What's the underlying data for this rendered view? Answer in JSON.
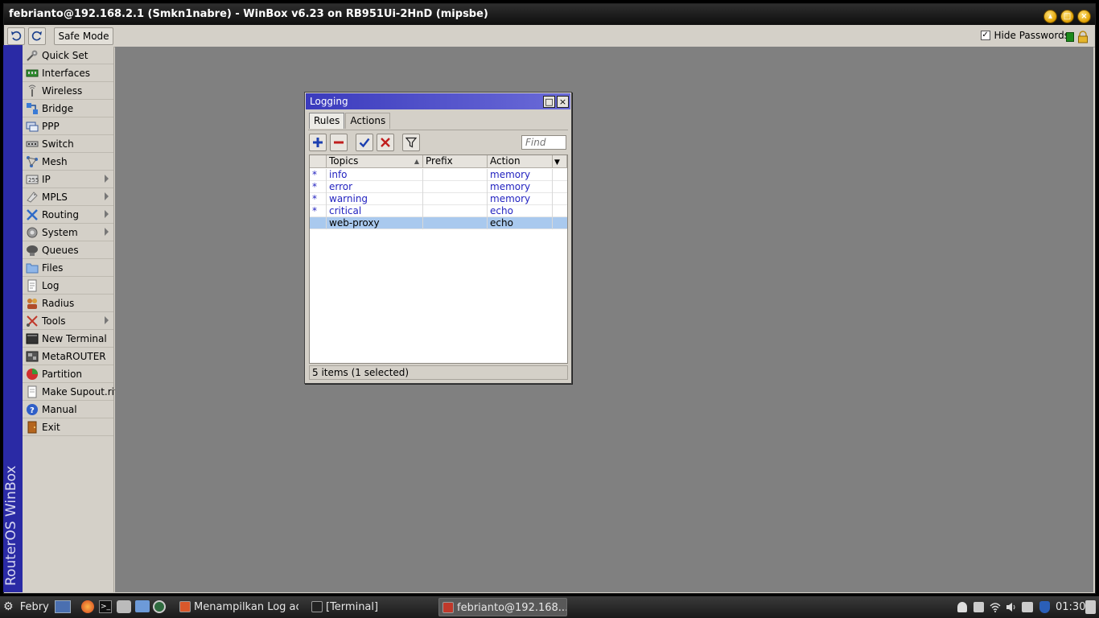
{
  "window": {
    "title": "febrianto@192.168.2.1 (Smkn1nabre) - WinBox v6.23 on RB951Ui-2HnD (mipsbe)"
  },
  "toolbar": {
    "safe_mode_label": "Safe Mode",
    "hide_passwords_label": "Hide Passwords",
    "hide_passwords_checked": true
  },
  "brand": "RouterOS WinBox",
  "sidebar": {
    "items": [
      {
        "label": "Quick Set",
        "icon": "quickset-icon",
        "submenu": false
      },
      {
        "label": "Interfaces",
        "icon": "interfaces-icon",
        "submenu": false
      },
      {
        "label": "Wireless",
        "icon": "wireless-icon",
        "submenu": false
      },
      {
        "label": "Bridge",
        "icon": "bridge-icon",
        "submenu": false
      },
      {
        "label": "PPP",
        "icon": "ppp-icon",
        "submenu": false
      },
      {
        "label": "Switch",
        "icon": "switch-icon",
        "submenu": false
      },
      {
        "label": "Mesh",
        "icon": "mesh-icon",
        "submenu": false
      },
      {
        "label": "IP",
        "icon": "ip-icon",
        "submenu": true
      },
      {
        "label": "MPLS",
        "icon": "mpls-icon",
        "submenu": true
      },
      {
        "label": "Routing",
        "icon": "routing-icon",
        "submenu": true
      },
      {
        "label": "System",
        "icon": "system-icon",
        "submenu": true
      },
      {
        "label": "Queues",
        "icon": "queues-icon",
        "submenu": false
      },
      {
        "label": "Files",
        "icon": "files-icon",
        "submenu": false
      },
      {
        "label": "Log",
        "icon": "log-icon",
        "submenu": false
      },
      {
        "label": "Radius",
        "icon": "radius-icon",
        "submenu": false
      },
      {
        "label": "Tools",
        "icon": "tools-icon",
        "submenu": true
      },
      {
        "label": "New Terminal",
        "icon": "terminal-icon",
        "submenu": false
      },
      {
        "label": "MetaROUTER",
        "icon": "metarouter-icon",
        "submenu": false
      },
      {
        "label": "Partition",
        "icon": "partition-icon",
        "submenu": false
      },
      {
        "label": "Make Supout.rif",
        "icon": "supout-icon",
        "submenu": false
      },
      {
        "label": "Manual",
        "icon": "manual-icon",
        "submenu": false
      },
      {
        "label": "Exit",
        "icon": "exit-icon",
        "submenu": false
      }
    ]
  },
  "logging": {
    "title": "Logging",
    "tabs": [
      {
        "label": "Rules",
        "active": true
      },
      {
        "label": "Actions",
        "active": false
      }
    ],
    "find_placeholder": "Find",
    "columns": [
      "Topics",
      "Prefix",
      "Action"
    ],
    "rows": [
      {
        "flag": "*",
        "topics": "info",
        "prefix": "",
        "action": "memory",
        "default": true,
        "selected": false
      },
      {
        "flag": "*",
        "topics": "error",
        "prefix": "",
        "action": "memory",
        "default": true,
        "selected": false
      },
      {
        "flag": "*",
        "topics": "warning",
        "prefix": "",
        "action": "memory",
        "default": true,
        "selected": false
      },
      {
        "flag": "*",
        "topics": "critical",
        "prefix": "",
        "action": "echo",
        "default": true,
        "selected": false
      },
      {
        "flag": "",
        "topics": "web-proxy",
        "prefix": "",
        "action": "echo",
        "default": false,
        "selected": true
      }
    ],
    "status": "5 items (1 selected)"
  },
  "taskbar": {
    "user": "Febry",
    "apps": [
      {
        "label": "Menampilkan Log ac...",
        "active": false
      },
      {
        "label": "[Terminal]",
        "active": false
      },
      {
        "label": "febrianto@192.168....",
        "active": true
      }
    ],
    "clock": "01:30"
  },
  "colors": {
    "brand_strip": "#2a2aa5",
    "workspace": "#808080",
    "dialog_title": "#3b3bbd",
    "selected_row": "#a9c9ee"
  }
}
